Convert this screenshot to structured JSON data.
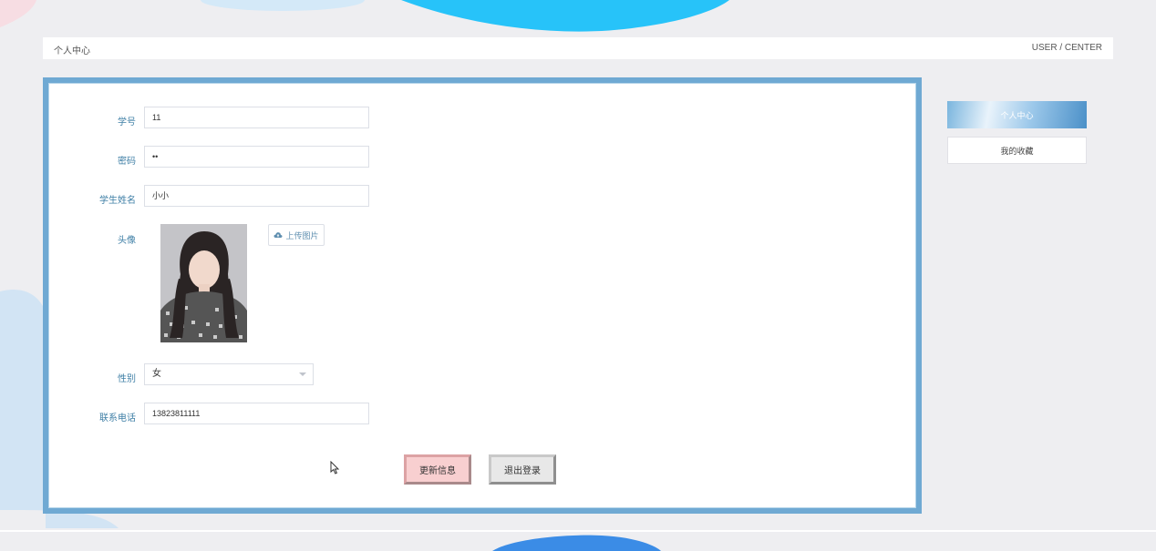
{
  "header": {
    "breadcrumb": "个人中心",
    "right_text": "USER / CENTER"
  },
  "form": {
    "student_no": {
      "label": "学号",
      "value": "11"
    },
    "password": {
      "label": "密码",
      "value": "••"
    },
    "student_name": {
      "label": "学生姓名",
      "value": "小小"
    },
    "avatar": {
      "label": "头像",
      "upload_label": "上传图片"
    },
    "gender": {
      "label": "性别",
      "value": "女"
    },
    "phone": {
      "label": "联系电话",
      "value": "13823811111"
    }
  },
  "actions": {
    "update_label": "更新信息",
    "logout_label": "退出登录"
  },
  "side_menu": {
    "items": [
      {
        "label": "个人中心",
        "active": true
      },
      {
        "label": "我的收藏",
        "active": false
      }
    ]
  },
  "colors": {
    "accent": "#6fa9d3",
    "label": "#3f7fa6",
    "update_btn": "#f8cfd0",
    "logout_btn": "#e8e8e8"
  }
}
